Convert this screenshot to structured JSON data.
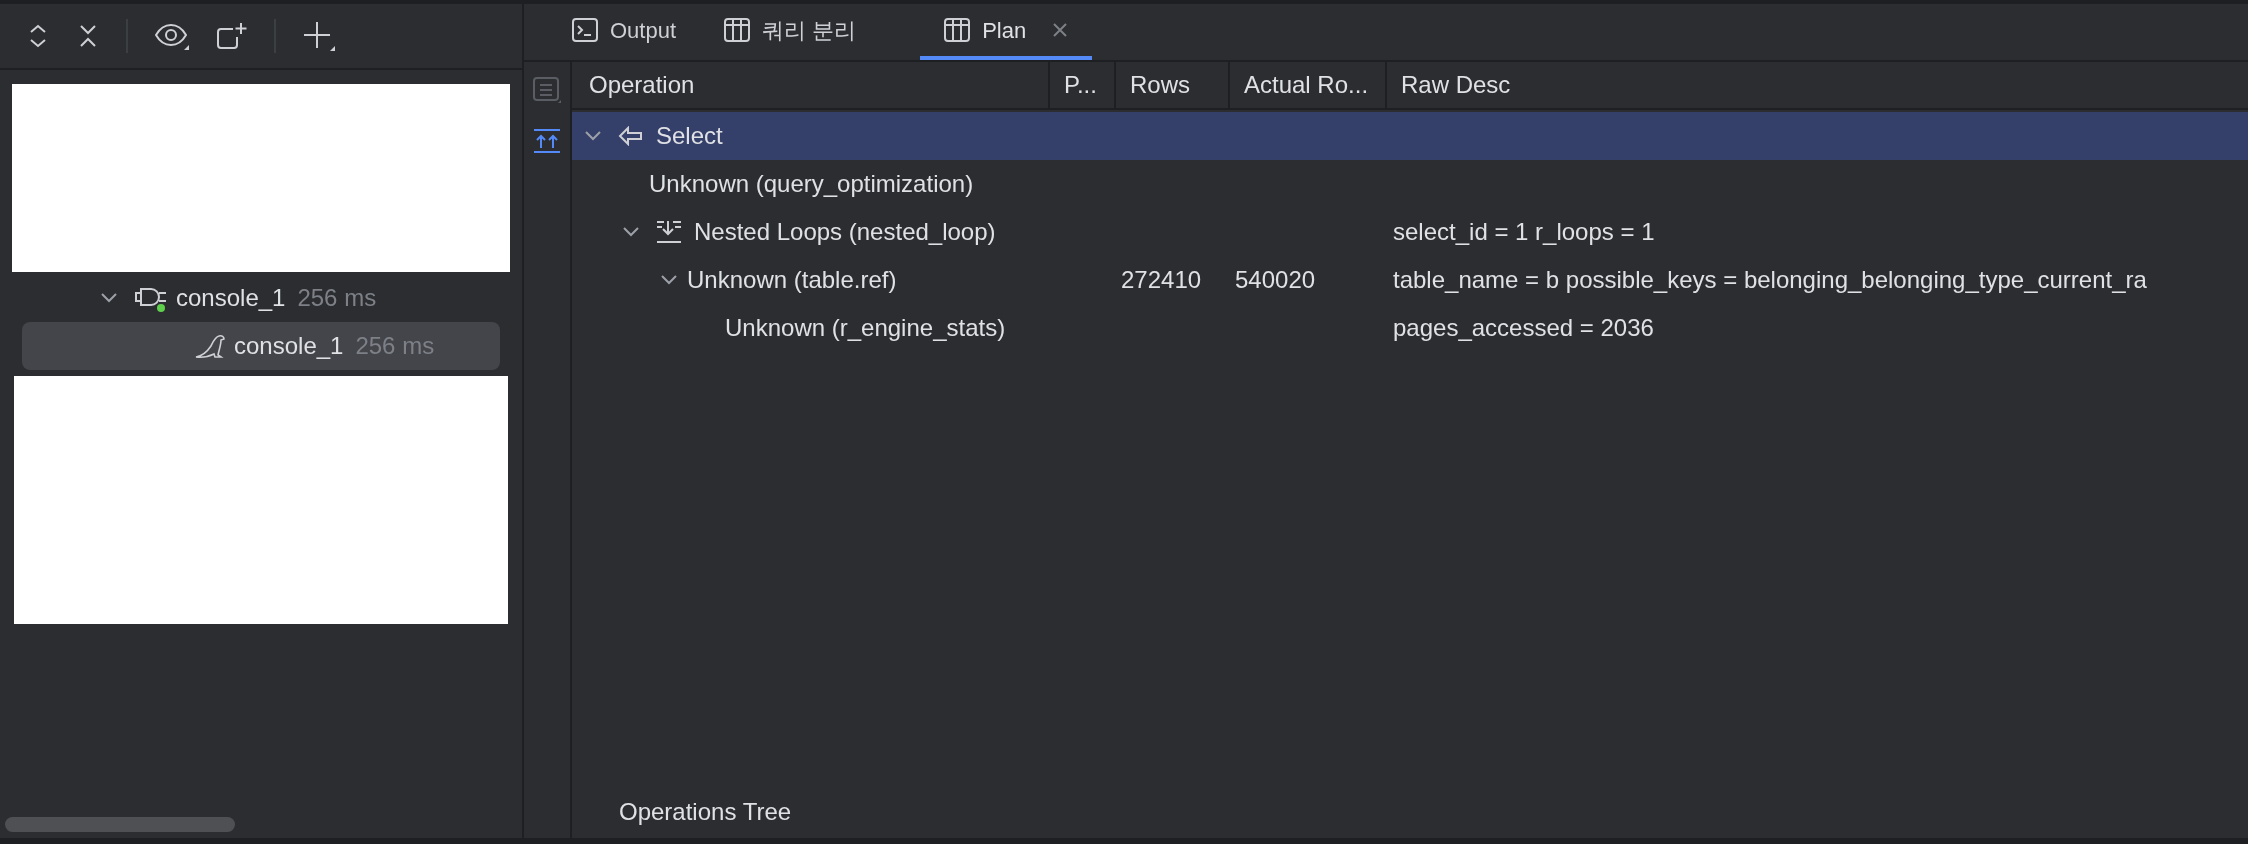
{
  "sidebar": {
    "tree": [
      {
        "name": "console_1",
        "time": "256 ms",
        "kind": "connection",
        "expanded": true,
        "selected": false,
        "children": [
          {
            "name": "console_1",
            "time": "256 ms",
            "kind": "session",
            "selected": true
          }
        ]
      }
    ]
  },
  "tabs": [
    {
      "label": "Output",
      "kind": "console",
      "selected": false
    },
    {
      "label": "쿼리 분리",
      "kind": "grid",
      "selected": false
    },
    {
      "label": "Plan",
      "kind": "grid",
      "selected": true
    }
  ],
  "table": {
    "columns": [
      "Operation",
      "P...",
      "Rows",
      "Actual Ro...",
      "Raw Desc"
    ],
    "rows": [
      {
        "operation": "Select",
        "kind": "select",
        "expanded": true,
        "selected": true,
        "children": [
          {
            "operation": "Unknown (query_optimization)",
            "selected": false
          },
          {
            "operation": "Nested Loops (nested_loop)",
            "kind": "nested_loop",
            "expanded": true,
            "selected": false,
            "raw_desc": "select_id = 1 r_loops = 1",
            "children": [
              {
                "operation": "Unknown (table.ref)",
                "expanded": true,
                "selected": false,
                "rows": "272410",
                "actual_rows": "540020",
                "raw_desc": "table_name = b possible_keys = belonging_belonging_type_current_ra",
                "children": [
                  {
                    "operation": "Unknown (r_engine_stats)",
                    "selected": false,
                    "raw_desc": "pages_accessed = 2036"
                  }
                ]
              }
            ]
          }
        ]
      }
    ]
  },
  "footer": {
    "label": "Operations Tree"
  }
}
